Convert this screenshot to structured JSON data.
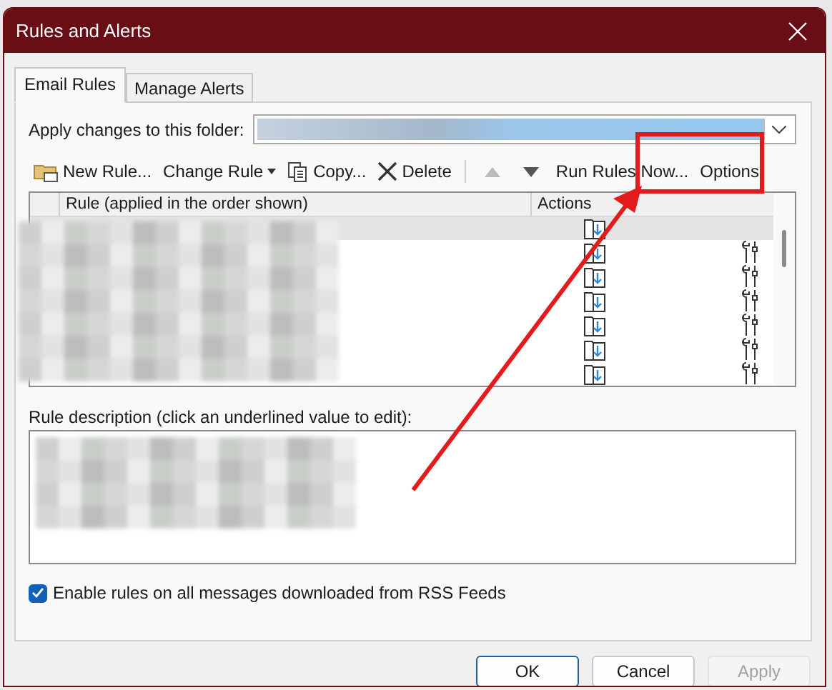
{
  "window": {
    "title": "Rules and Alerts"
  },
  "tabs": [
    {
      "label": "Email Rules",
      "selected": true
    },
    {
      "label": "Manage Alerts",
      "selected": false
    }
  ],
  "folder": {
    "label": "Apply changes to this folder:"
  },
  "toolbar": [
    {
      "kind": "new",
      "label": "New Rule...",
      "disabled": false
    },
    {
      "kind": "change",
      "label": "Change Rule",
      "disabled": false
    },
    {
      "kind": "copy",
      "label": "Copy...",
      "disabled": false
    },
    {
      "kind": "delete",
      "label": "Delete",
      "disabled": false
    },
    {
      "kind": "up",
      "disabled": true
    },
    {
      "kind": "down",
      "disabled": false
    },
    {
      "kind": "run",
      "label": "Run Rules Now...",
      "disabled": false
    },
    {
      "kind": "options",
      "label": "Options",
      "disabled": false
    }
  ],
  "table": {
    "columns": [
      "Rule (applied in the order shown)",
      "Actions"
    ],
    "rows": [
      {
        "selected": true,
        "client_only": false
      },
      {
        "selected": false,
        "client_only": true
      },
      {
        "selected": false,
        "client_only": true
      },
      {
        "selected": false,
        "client_only": true
      },
      {
        "selected": false,
        "client_only": true
      },
      {
        "selected": false,
        "client_only": true
      },
      {
        "selected": false,
        "client_only": true
      }
    ]
  },
  "description": {
    "label": "Rule description (click an underlined value to edit):"
  },
  "rss": {
    "label": "Enable rules on all messages downloaded from RSS Feeds",
    "checked": true
  },
  "buttons": [
    {
      "label": "OK",
      "default": true,
      "disabled": false
    },
    {
      "label": "Cancel",
      "default": false,
      "disabled": false
    },
    {
      "label": "Apply",
      "default": false,
      "disabled": true
    }
  ]
}
